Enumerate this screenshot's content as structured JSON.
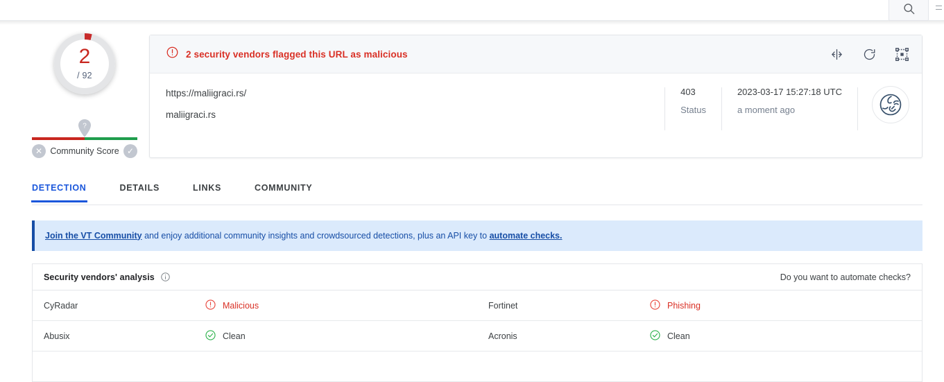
{
  "topbar": {
    "search_icon": "search-icon"
  },
  "score": {
    "value": "2",
    "total": "/ 92",
    "community_label": "Community Score",
    "pin_glyph": "?",
    "negative_glyph": "✕",
    "positive_glyph": "✓",
    "red": "#c8271f",
    "green": "#1f9d4d",
    "ring_bg": "#e4e5e7"
  },
  "card": {
    "verdict": "2 security vendors flagged this URL as malicious",
    "verdict_color": "#d93025",
    "actions": [
      {
        "name": "compare-icon"
      },
      {
        "name": "reanalyze-icon"
      },
      {
        "name": "focus-icon"
      }
    ],
    "url": "https://maliigraci.rs/",
    "domain": "maliigraci.rs",
    "status_value": "403",
    "status_label": "Status",
    "scan_date": "2023-03-17 15:27:18 UTC",
    "scan_relative": "a moment ago",
    "type_icon": "url-globe-icon"
  },
  "tabs": [
    {
      "label": "DETECTION",
      "active": true
    },
    {
      "label": "DETAILS",
      "active": false
    },
    {
      "label": "LINKS",
      "active": false
    },
    {
      "label": "COMMUNITY",
      "active": false
    }
  ],
  "banner": {
    "link_start": "Join the VT Community",
    "middle": " and enjoy additional community insights and crowdsourced detections, plus an API key to ",
    "link_end": "automate checks.",
    "accent": "#174ea6",
    "bg": "#dbeafc"
  },
  "vendors_section": {
    "title": "Security vendors' analysis",
    "info_icon": "info-icon",
    "automate_text": "Do you want to automate checks?",
    "rows": [
      [
        {
          "vendor": "CyRadar",
          "verdict": "Malicious",
          "status": "bad"
        },
        {
          "vendor": "Fortinet",
          "verdict": "Phishing",
          "status": "bad"
        }
      ],
      [
        {
          "vendor": "Abusix",
          "verdict": "Clean",
          "status": "good"
        },
        {
          "vendor": "Acronis",
          "verdict": "Clean",
          "status": "good"
        }
      ]
    ]
  }
}
